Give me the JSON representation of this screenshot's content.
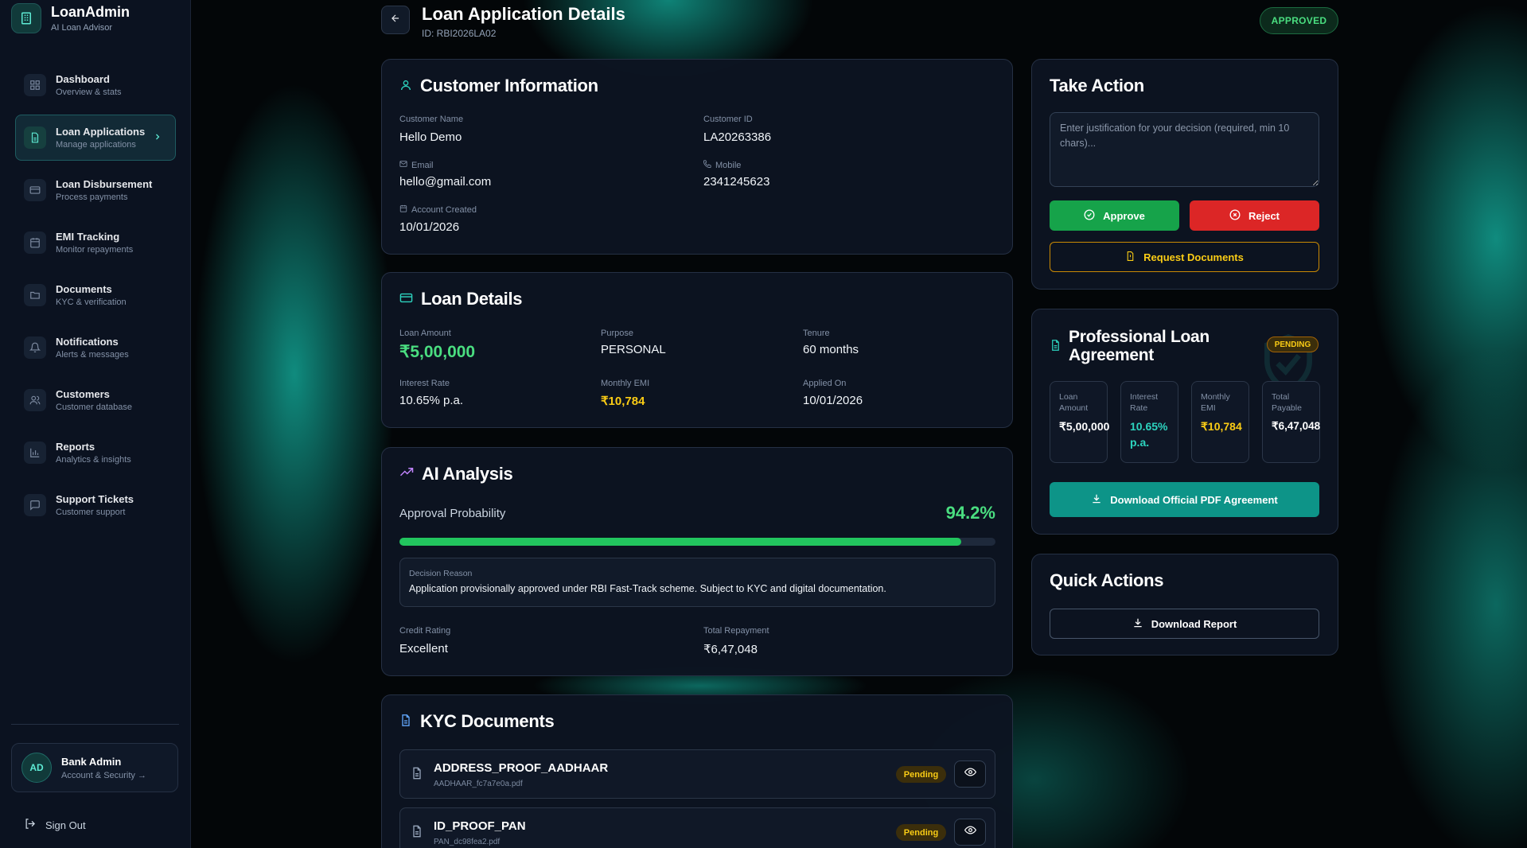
{
  "brand": {
    "name": "LoanAdmin",
    "subtitle": "AI Loan Advisor"
  },
  "sidebar": {
    "items": [
      {
        "label": "Dashboard",
        "sub": "Overview & stats",
        "icon": "grid-icon"
      },
      {
        "label": "Loan Applications",
        "sub": "Manage applications",
        "icon": "file-text-icon",
        "active": true
      },
      {
        "label": "Loan Disbursement",
        "sub": "Process payments",
        "icon": "credit-card-icon"
      },
      {
        "label": "EMI Tracking",
        "sub": "Monitor repayments",
        "icon": "calendar-icon"
      },
      {
        "label": "Documents",
        "sub": "KYC & verification",
        "icon": "folder-icon"
      },
      {
        "label": "Notifications",
        "sub": "Alerts & messages",
        "icon": "bell-icon"
      },
      {
        "label": "Customers",
        "sub": "Customer database",
        "icon": "users-icon"
      },
      {
        "label": "Reports",
        "sub": "Analytics & insights",
        "icon": "bar-chart-icon"
      },
      {
        "label": "Support Tickets",
        "sub": "Customer support",
        "icon": "message-icon"
      }
    ],
    "user": {
      "initials": "AD",
      "name": "Bank Admin",
      "sub": "Account & Security →"
    },
    "signout": "Sign Out"
  },
  "header": {
    "title": "Loan Application Details",
    "id": "ID: RBI2026LA02",
    "status": "APPROVED"
  },
  "customer": {
    "title": "Customer Information",
    "name_label": "Customer Name",
    "name": "Hello Demo",
    "id_label": "Customer ID",
    "id": "LA20263386",
    "email_label": "Email",
    "email": "hello@gmail.com",
    "mobile_label": "Mobile",
    "mobile": "2341245623",
    "created_label": "Account Created",
    "created": "10/01/2026"
  },
  "loan": {
    "title": "Loan Details",
    "amount_label": "Loan Amount",
    "amount": "₹5,00,000",
    "purpose_label": "Purpose",
    "purpose": "PERSONAL",
    "tenure_label": "Tenure",
    "tenure": "60 months",
    "rate_label": "Interest Rate",
    "rate": "10.65% p.a.",
    "emi_label": "Monthly EMI",
    "emi": "₹10,784",
    "applied_label": "Applied On",
    "applied": "10/01/2026"
  },
  "ai": {
    "title": "AI Analysis",
    "prob_label": "Approval Probability",
    "prob": "94.2%",
    "prob_value": 94.2,
    "reason_label": "Decision Reason",
    "reason": "Application provisionally approved under RBI Fast-Track scheme. Subject to KYC and digital documentation.",
    "credit_label": "Credit Rating",
    "credit": "Excellent",
    "repay_label": "Total Repayment",
    "repay": "₹6,47,048"
  },
  "kyc": {
    "title": "KYC Documents",
    "docs": [
      {
        "name": "ADDRESS_PROOF_AADHAAR",
        "file": "AADHAAR_fc7a7e0a.pdf",
        "status": "Pending"
      },
      {
        "name": "ID_PROOF_PAN",
        "file": "PAN_dc98fea2.pdf",
        "status": "Pending"
      }
    ]
  },
  "action": {
    "title": "Take Action",
    "placeholder": "Enter justification for your decision (required, min 10 chars)...",
    "approve": "Approve",
    "reject": "Reject",
    "request": "Request Documents"
  },
  "agreement": {
    "title": "Professional Loan Agreement",
    "status": "PENDING",
    "boxes": [
      {
        "label": "Loan Amount",
        "value": "₹5,00,000",
        "color": "#ffffff"
      },
      {
        "label": "Interest Rate",
        "value": "10.65% p.a.",
        "color": "#2dd4bf"
      },
      {
        "label": "Monthly EMI",
        "value": "₹10,784",
        "color": "#facc15"
      },
      {
        "label": "Total Payable",
        "value": "₹6,47,048",
        "color": "#ffffff"
      }
    ],
    "download": "Download Official PDF Agreement"
  },
  "quick": {
    "title": "Quick Actions",
    "report": "Download Report"
  },
  "colors": {
    "accent": "#14b8a6",
    "success": "#22c55e",
    "danger": "#dc2626",
    "warning": "#facc15"
  }
}
